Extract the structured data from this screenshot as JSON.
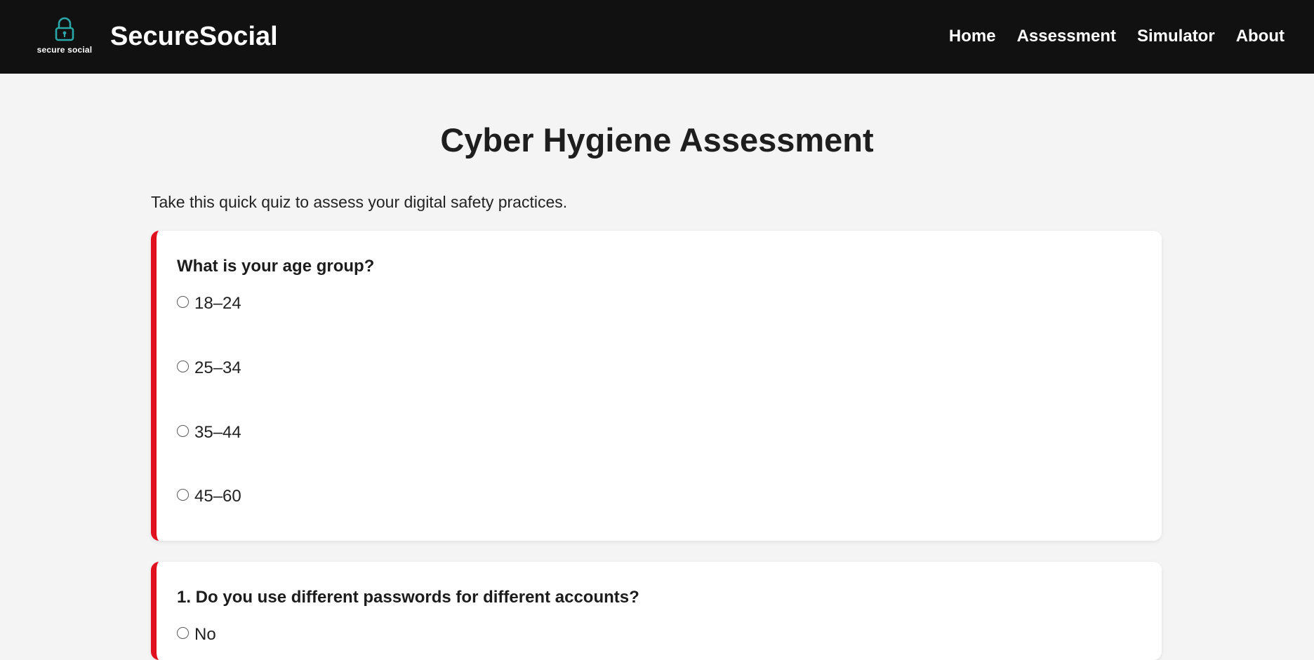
{
  "header": {
    "logo_caption": "secure social",
    "brand": "SecureSocial",
    "nav": [
      "Home",
      "Assessment",
      "Simulator",
      "About"
    ]
  },
  "main": {
    "title": "Cyber Hygiene Assessment",
    "intro": "Take this quick quiz to assess your digital safety practices.",
    "questions": [
      {
        "text": "What is your age group?",
        "options": [
          "18–24",
          "25–34",
          "35–44",
          "45–60"
        ]
      },
      {
        "text": "1. Do you use different passwords for different accounts?",
        "options": [
          "No"
        ]
      }
    ]
  },
  "colors": {
    "header_bg": "#111111",
    "accent_red": "#e0101e",
    "logo_teal": "#2aa7a8",
    "page_bg": "#f4f4f4"
  }
}
